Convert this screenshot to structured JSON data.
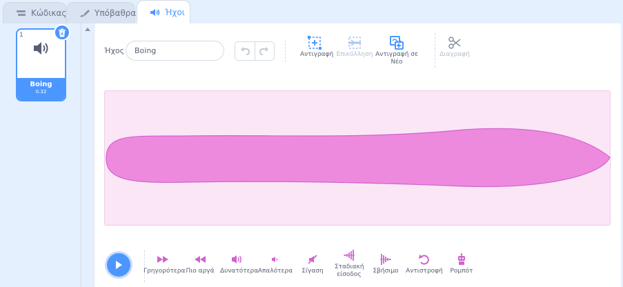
{
  "tabs": [
    {
      "label": "Κώδικας",
      "icon": "code-icon"
    },
    {
      "label": "Υπόβαθρα",
      "icon": "paintbrush-icon"
    },
    {
      "label": "Ήχοι",
      "icon": "speaker-icon",
      "active": true
    }
  ],
  "sound_list": {
    "items": [
      {
        "number": "1",
        "name": "Boing",
        "duration": "0.32",
        "icon": "speaker-icon",
        "selected": true
      }
    ]
  },
  "editor": {
    "sound_name_label": "Ήχος",
    "sound_name_value": "Boing",
    "toolbar": {
      "copy": "Αντιγραφή",
      "paste": "Επικόλληση",
      "copy_to_new": "Αντιγραφή σε Νέο",
      "delete": "Διαγραφή"
    },
    "effects": [
      {
        "label": "Γρηγορότερα",
        "icon": "faster-icon"
      },
      {
        "label": "Πιο αργά",
        "icon": "slower-icon"
      },
      {
        "label": "Δυνατότερα",
        "icon": "louder-icon"
      },
      {
        "label": "Απαλότερα",
        "icon": "softer-icon"
      },
      {
        "label": "Σίγαση",
        "icon": "mute-icon"
      },
      {
        "label": "Σταδιακή είσοδος",
        "icon": "fade-in-icon"
      },
      {
        "label": "Σβήσιμο",
        "icon": "fade-out-icon"
      },
      {
        "label": "Αντιστροφή",
        "icon": "reverse-icon"
      },
      {
        "label": "Ρομπότ",
        "icon": "robot-icon"
      }
    ]
  },
  "colors": {
    "accent": "#4c97ff",
    "sound_pink": "#cf63cf",
    "waveform_fill": "#ee8ade",
    "waveform_bg": "#fbe6f6"
  }
}
